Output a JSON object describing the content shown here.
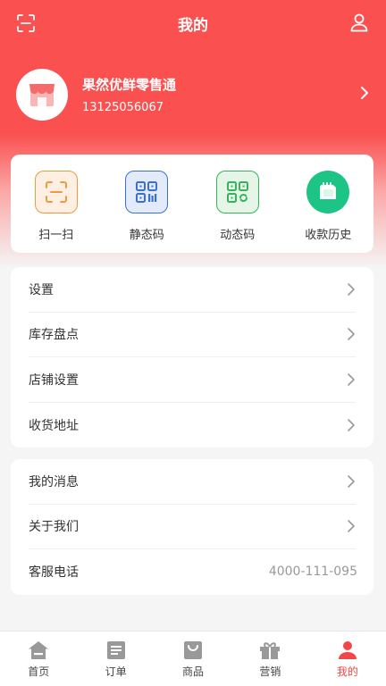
{
  "header": {
    "title": "我的"
  },
  "profile": {
    "name": "果然优鲜零售通",
    "phone": "13125056067"
  },
  "quick_actions": [
    {
      "label": "扫一扫",
      "icon": "scan-icon"
    },
    {
      "label": "静态码",
      "icon": "static-qr-icon"
    },
    {
      "label": "动态码",
      "icon": "dynamic-qr-icon"
    },
    {
      "label": "收款历史",
      "icon": "payment-history-icon"
    }
  ],
  "menu_group1": [
    {
      "label": "设置"
    },
    {
      "label": "库存盘点"
    },
    {
      "label": "店铺设置"
    },
    {
      "label": "收货地址"
    }
  ],
  "menu_group2": [
    {
      "label": "我的消息"
    },
    {
      "label": "关于我们"
    },
    {
      "label": "客服电话",
      "value": "4000-111-095"
    }
  ],
  "tabbar": [
    {
      "label": "首页",
      "icon": "home-icon"
    },
    {
      "label": "订单",
      "icon": "order-icon"
    },
    {
      "label": "商品",
      "icon": "product-bag-icon"
    },
    {
      "label": "营销",
      "icon": "gift-icon"
    },
    {
      "label": "我的",
      "icon": "user-icon",
      "active": true
    }
  ],
  "colors": {
    "brand": "#fa5150",
    "scan_accent": "#f09a40",
    "static_qr_accent": "#3a6fd8",
    "dynamic_qr_accent": "#34b55a",
    "history_accent": "#1cc486",
    "tab_active": "#f04848",
    "tab_inactive": "#999999"
  }
}
